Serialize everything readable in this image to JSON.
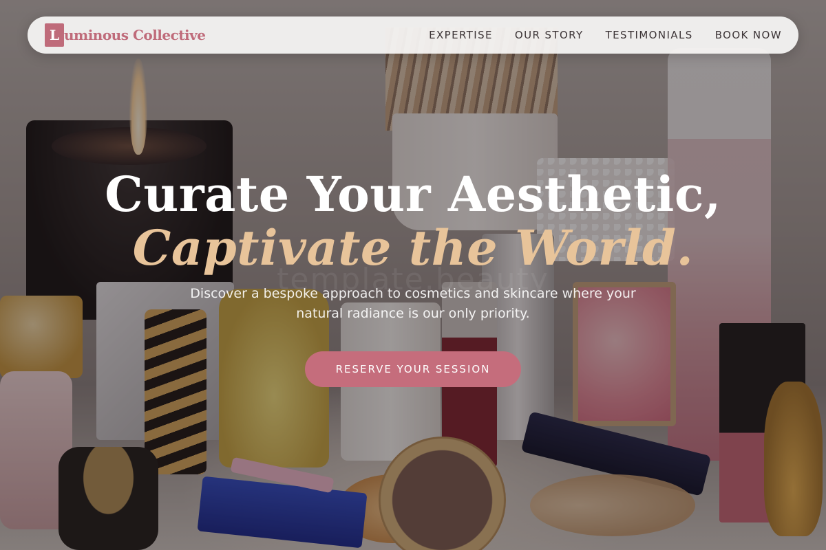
{
  "brand": {
    "mark": "L",
    "name": "uminous Collective",
    "accent_color": "#bf6b7a"
  },
  "nav": {
    "items": [
      {
        "label": "EXPERTISE"
      },
      {
        "label": "OUR STORY"
      },
      {
        "label": "TESTIMONIALS"
      },
      {
        "label": "BOOK NOW"
      }
    ]
  },
  "hero": {
    "title_line1": "Curate Your Aesthetic,",
    "title_line2": "Captivate the World.",
    "title_line2_color": "#e8c49a",
    "watermark": "template.beauty",
    "subtitle": "Discover a bespoke approach to cosmetics and skincare where your natural radiance is our only priority.",
    "cta_label": "RESERVE YOUR SESSION",
    "cta_color": "#c56d7c"
  }
}
